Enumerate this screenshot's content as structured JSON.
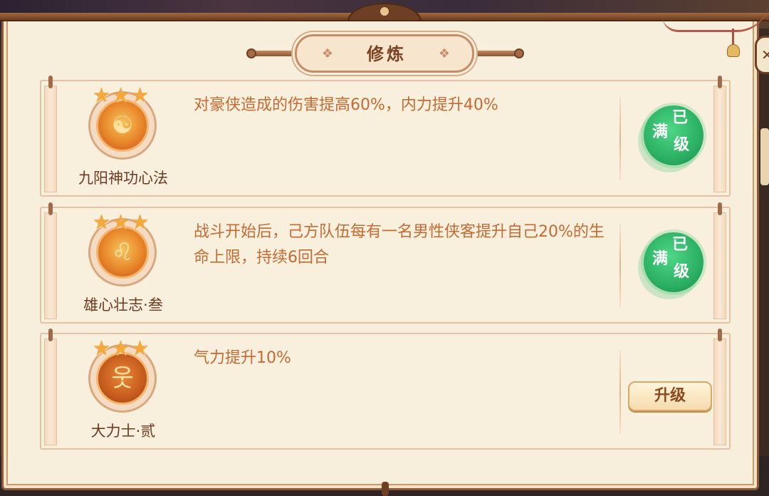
{
  "panel": {
    "title": "修炼",
    "title_decor_icon": "diamond-ornament"
  },
  "skills": [
    {
      "name": "九阳神功心法",
      "stars": 3,
      "icon": "yin-yang-orb-icon",
      "description": "对豪侠造成的伤害提高60%，内力提升40%",
      "status": "maxed",
      "maxed_label": [
        "满",
        "已",
        "级"
      ]
    },
    {
      "name": "雄心壮志·叁",
      "stars": 3,
      "icon": "lion-head-icon",
      "description": "战斗开始后，己方队伍每有一名男性侠客提升自己20%的生命上限，持续6回合",
      "status": "maxed",
      "maxed_label": [
        "满",
        "已",
        "级"
      ]
    },
    {
      "name": "大力士·贰",
      "stars": 3,
      "icon": "strongman-icon",
      "description": "气力提升10%",
      "status": "upgradable",
      "button_label": "升级"
    }
  ],
  "colors": {
    "frame": "#8a5a3a",
    "panel_bg": "#f7efdc",
    "desc_text": "#c26b34",
    "name_text": "#6b3b22",
    "star": "#f5a83b",
    "maxed_badge": "#2bb064"
  }
}
